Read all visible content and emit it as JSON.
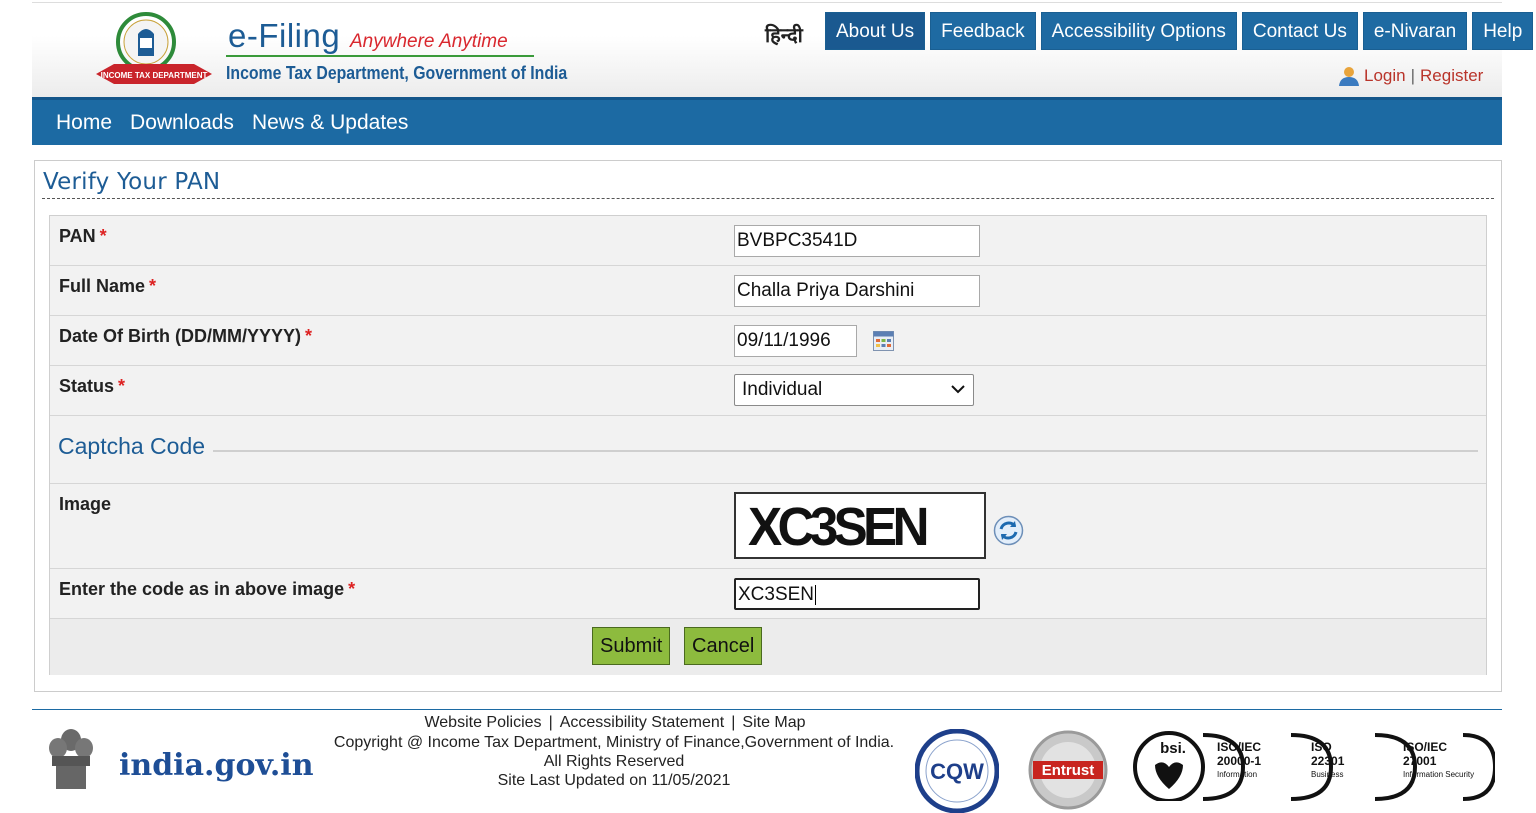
{
  "header": {
    "title": "e-Filing",
    "tagline": "Anywhere Anytime",
    "department": "Income Tax Department, Government of India",
    "emblem_text": "INCOME TAX DEPARTMENT",
    "hindi_link": "हिन्दी",
    "top_nav": [
      "About Us",
      "Feedback",
      "Accessibility Options",
      "Contact Us",
      "e-Nivaran",
      "Help"
    ],
    "login": "Login",
    "separator": "|",
    "register": "Register"
  },
  "main_nav": [
    "Home",
    "Downloads",
    "News & Updates"
  ],
  "page": {
    "heading": "Verify Your PAN",
    "required_mark": "*",
    "fields": {
      "pan": {
        "label": "PAN",
        "value": "BVBPC3541D"
      },
      "full_name": {
        "label": "Full Name",
        "value": "Challa Priya Darshini"
      },
      "dob": {
        "label": "Date Of Birth (DD/MM/YYYY)",
        "value": "09/11/1996"
      },
      "status": {
        "label": "Status",
        "value": "Individual"
      }
    },
    "captcha": {
      "section_title": "Captcha Code",
      "image_label": "Image",
      "image_text": "XC3SEN",
      "input_label": "Enter the code as in above image",
      "input_value": "XC3SEN"
    },
    "buttons": {
      "submit": "Submit",
      "cancel": "Cancel"
    }
  },
  "footer": {
    "links": [
      "Website Policies",
      "Accessibility Statement",
      "Site Map"
    ],
    "link_separator": "|",
    "copyright": "Copyright @ Income Tax Department, Ministry of Finance,Government of India.",
    "rights": "All Rights Reserved",
    "updated": "Site Last Updated on 11/05/2021",
    "india_gov": "india.gov.in",
    "cert_cqw": "CQW",
    "cert_entrust": "Entrust",
    "cert_bsi": "bsi.",
    "iso_1_title": "ISO/IEC",
    "iso_1_num": "20000-1",
    "iso_1_desc": "Information",
    "iso_2_title": "ISO",
    "iso_2_num": "22301",
    "iso_2_desc": "Business",
    "iso_3_title": "ISO/IEC",
    "iso_3_num": "27001",
    "iso_3_desc": "Information Security"
  },
  "colors": {
    "brand_blue": "#1c6aa3",
    "accent_red": "#d9272e",
    "button_green": "#8dbb3e"
  }
}
